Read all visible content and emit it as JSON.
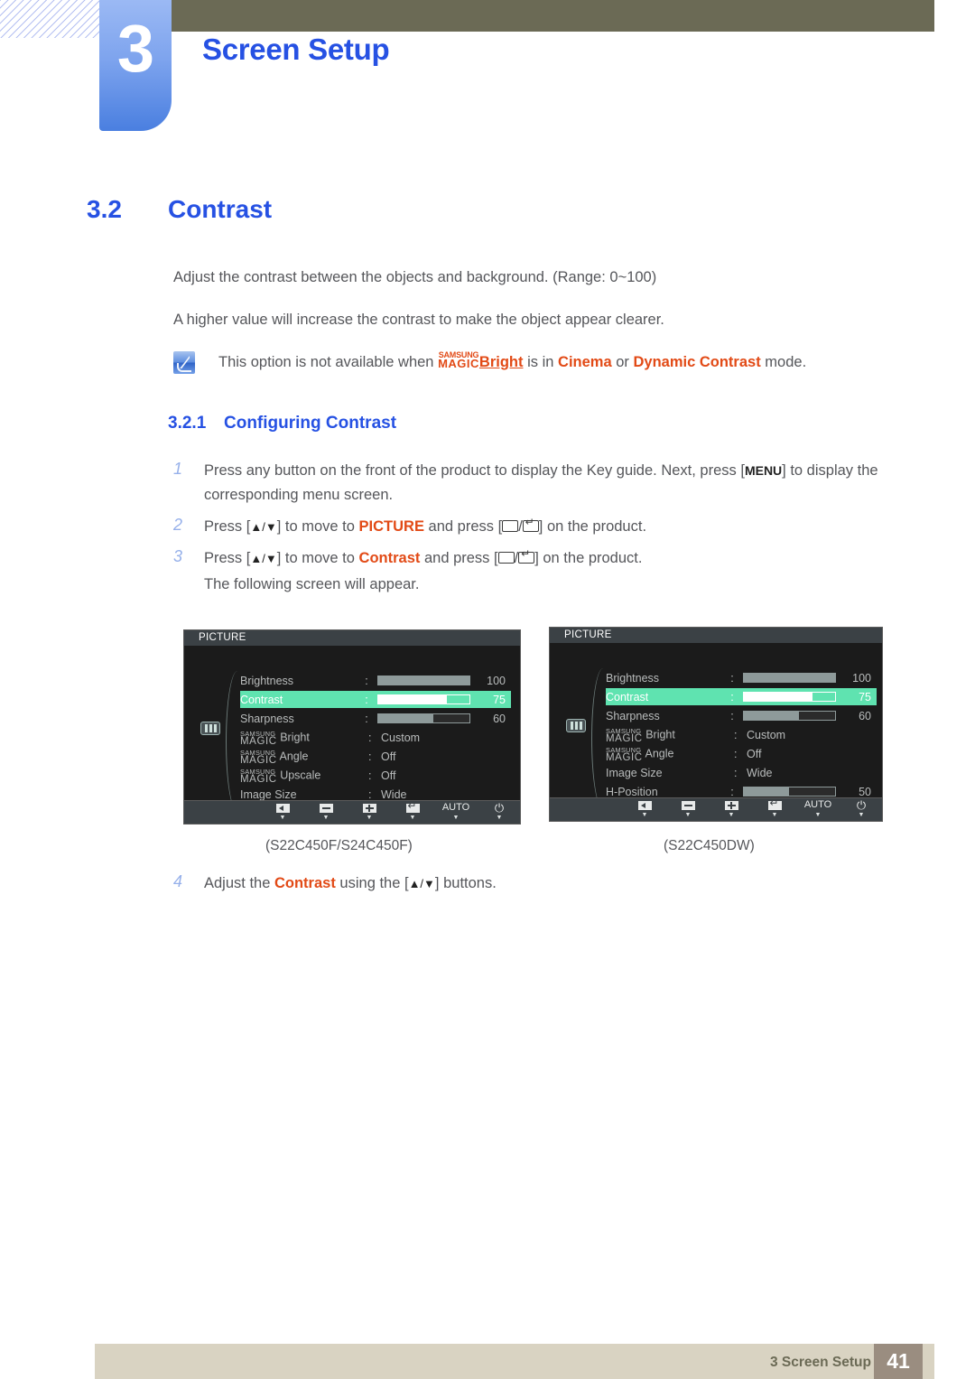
{
  "chapter": {
    "number": "3",
    "title": "Screen Setup"
  },
  "section": {
    "number": "3.2",
    "title": "Contrast"
  },
  "body": {
    "paragraph1": "Adjust the contrast between the objects and background. (Range: 0~100)",
    "paragraph2": "A higher value will increase the contrast to make the object appear clearer."
  },
  "note": {
    "icon": "note-pencil-icon",
    "text_before": "This option is not available when",
    "magic_top": "SAMSUNG",
    "magic_bottom": "MAGIC",
    "magic_suffix": "Bright",
    "text_mid": "is in",
    "mode1": "Cinema",
    "text_or": "or",
    "mode2": "Dynamic Contrast",
    "text_after": "mode."
  },
  "subsection": {
    "number": "3.2.1",
    "title": "Configuring Contrast"
  },
  "steps": [
    {
      "number": "1",
      "part1": "Press any button on the front of the product to display the Key guide. Next, press [",
      "key": "MENU",
      "part2": "] to display the corresponding menu screen."
    },
    {
      "number": "2",
      "part1": "Press [",
      "arrows": "▲/▼",
      "part2": "] to move to",
      "highlight": "PICTURE",
      "part3": "and press [",
      "part4": "] on the product."
    },
    {
      "number": "3",
      "part1": "Press [",
      "arrows": "▲/▼",
      "part2": "] to move to",
      "highlight": "Contrast",
      "part3": "and press [",
      "part4": "] on the product.",
      "followup": "The following screen will appear."
    },
    {
      "number": "4",
      "part1": "Adjust the",
      "highlight": "Contrast",
      "part2": "using the [",
      "arrows": "▲/▼",
      "part3": "] buttons."
    }
  ],
  "osd_left": {
    "caption": "(S22C450F/S24C450F)",
    "header": "PICTURE",
    "side_icon": "picture-menu-icon",
    "rows": [
      {
        "label": "Brightness",
        "colon": ":",
        "type": "bar",
        "fill": 100,
        "value": "100",
        "selected": false
      },
      {
        "label": "Contrast",
        "colon": ":",
        "type": "bar",
        "fill": 75,
        "value": "75",
        "selected": true
      },
      {
        "label": "Sharpness",
        "colon": ":",
        "type": "bar",
        "fill": 60,
        "value": "60",
        "selected": false
      },
      {
        "label_magic_top": "SAMSUNG",
        "label_magic_bot": "MAGIC",
        "label_suffix": "Bright",
        "colon": ":",
        "type": "text",
        "value": "Custom",
        "selected": false
      },
      {
        "label_magic_top": "SAMSUNG",
        "label_magic_bot": "MAGIC",
        "label_suffix": "Angle",
        "colon": ":",
        "type": "text",
        "value": "Off",
        "selected": false
      },
      {
        "label_magic_top": "SAMSUNG",
        "label_magic_bot": "MAGIC",
        "label_suffix": "Upscale",
        "colon": ":",
        "type": "text",
        "value": "Off",
        "selected": false
      },
      {
        "label": "Image Size",
        "colon": ":",
        "type": "text",
        "value": "Wide",
        "selected": false
      }
    ],
    "scroll_down": "▼",
    "footer_buttons": [
      {
        "icon": "left-arrow-icon",
        "label": ""
      },
      {
        "icon": "minus-icon",
        "label": ""
      },
      {
        "icon": "plus-icon",
        "label": ""
      },
      {
        "icon": "enter-icon",
        "label": ""
      },
      {
        "icon": "auto-icon",
        "label": "AUTO"
      },
      {
        "icon": "power-icon",
        "label": ""
      }
    ]
  },
  "osd_right": {
    "caption": "(S22C450DW)",
    "header": "PICTURE",
    "side_icon": "picture-menu-icon",
    "rows": [
      {
        "label": "Brightness",
        "colon": ":",
        "type": "bar",
        "fill": 100,
        "value": "100",
        "selected": false
      },
      {
        "label": "Contrast",
        "colon": ":",
        "type": "bar",
        "fill": 75,
        "value": "75",
        "selected": true
      },
      {
        "label": "Sharpness",
        "colon": ":",
        "type": "bar",
        "fill": 60,
        "value": "60",
        "selected": false
      },
      {
        "label_magic_top": "SAMSUNG",
        "label_magic_bot": "MAGIC",
        "label_suffix": "Bright",
        "colon": ":",
        "type": "text",
        "value": "Custom",
        "selected": false
      },
      {
        "label_magic_top": "SAMSUNG",
        "label_magic_bot": "MAGIC",
        "label_suffix": "Angle",
        "colon": ":",
        "type": "text",
        "value": "Off",
        "selected": false
      },
      {
        "label": "Image Size",
        "colon": ":",
        "type": "text",
        "value": "Wide",
        "selected": false
      },
      {
        "label": "H-Position",
        "colon": ":",
        "type": "bar",
        "fill": 50,
        "value": "50",
        "selected": false
      }
    ],
    "scroll_down": "▼",
    "footer_buttons": [
      {
        "icon": "left-arrow-icon",
        "label": ""
      },
      {
        "icon": "minus-icon",
        "label": ""
      },
      {
        "icon": "plus-icon",
        "label": ""
      },
      {
        "icon": "enter-icon",
        "label": ""
      },
      {
        "icon": "auto-icon",
        "label": "AUTO"
      },
      {
        "icon": "power-icon",
        "label": ""
      }
    ]
  },
  "footer": {
    "label": "3 Screen Setup",
    "page": "41"
  },
  "colors": {
    "accent_blue": "#2651e3",
    "orange": "#e24a16",
    "olive": "#6b6a55",
    "osd_green": "#5fe3b0",
    "footer_bar": "#d9d3c2",
    "page_box": "#9a8d80"
  }
}
